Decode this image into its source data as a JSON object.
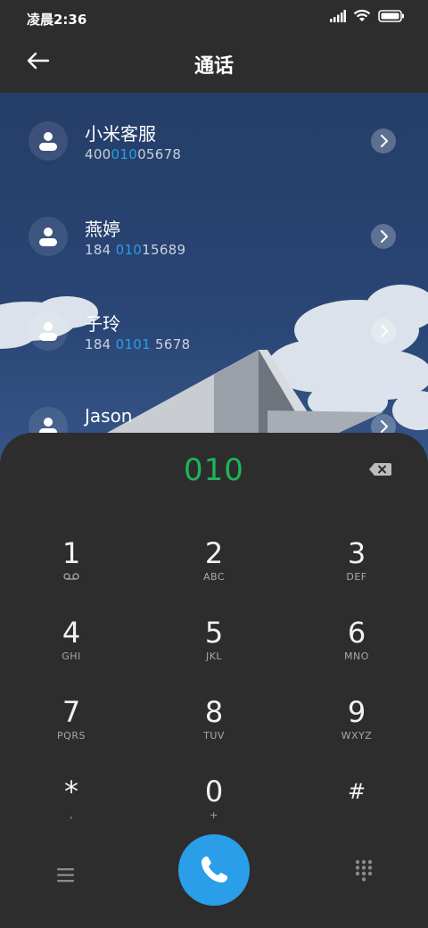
{
  "status": {
    "time": "凌晨2:36"
  },
  "header": {
    "title": "通话"
  },
  "contacts": [
    {
      "name": "小米客服",
      "num_pre": "400",
      "num_hl": "010",
      "num_post": "05678"
    },
    {
      "name": "燕婷",
      "num_pre": "184 ",
      "num_hl": "010",
      "num_post": "15689"
    },
    {
      "name": "子玲",
      "num_pre": "184 ",
      "num_hl": "0101",
      "num_post": " 5678"
    },
    {
      "name": "Jason",
      "num_pre": "",
      "num_hl": "",
      "num_post": ""
    }
  ],
  "dialer": {
    "input": "010",
    "keys": [
      {
        "digit": "1",
        "letters": ""
      },
      {
        "digit": "2",
        "letters": "ABC"
      },
      {
        "digit": "3",
        "letters": "DEF"
      },
      {
        "digit": "4",
        "letters": "GHI"
      },
      {
        "digit": "5",
        "letters": "JKL"
      },
      {
        "digit": "6",
        "letters": "MNO"
      },
      {
        "digit": "7",
        "letters": "PQRS"
      },
      {
        "digit": "8",
        "letters": "TUV"
      },
      {
        "digit": "9",
        "letters": "WXYZ"
      },
      {
        "digit": "*",
        "letters": ","
      },
      {
        "digit": "0",
        "letters": "+"
      },
      {
        "digit": "#",
        "letters": ""
      }
    ]
  },
  "colors": {
    "accent": "#2a9ee8",
    "digits": "#1fb45a",
    "sheet": "#2d2d2d"
  },
  "icons": {
    "signal": "signal-icon",
    "wifi": "wifi-icon",
    "battery": "battery-icon",
    "back": "back-arrow-icon",
    "delete": "backspace-icon",
    "menu": "menu-icon",
    "call": "phone-icon",
    "keypad": "keypad-icon",
    "voicemail": "voicemail-icon"
  }
}
